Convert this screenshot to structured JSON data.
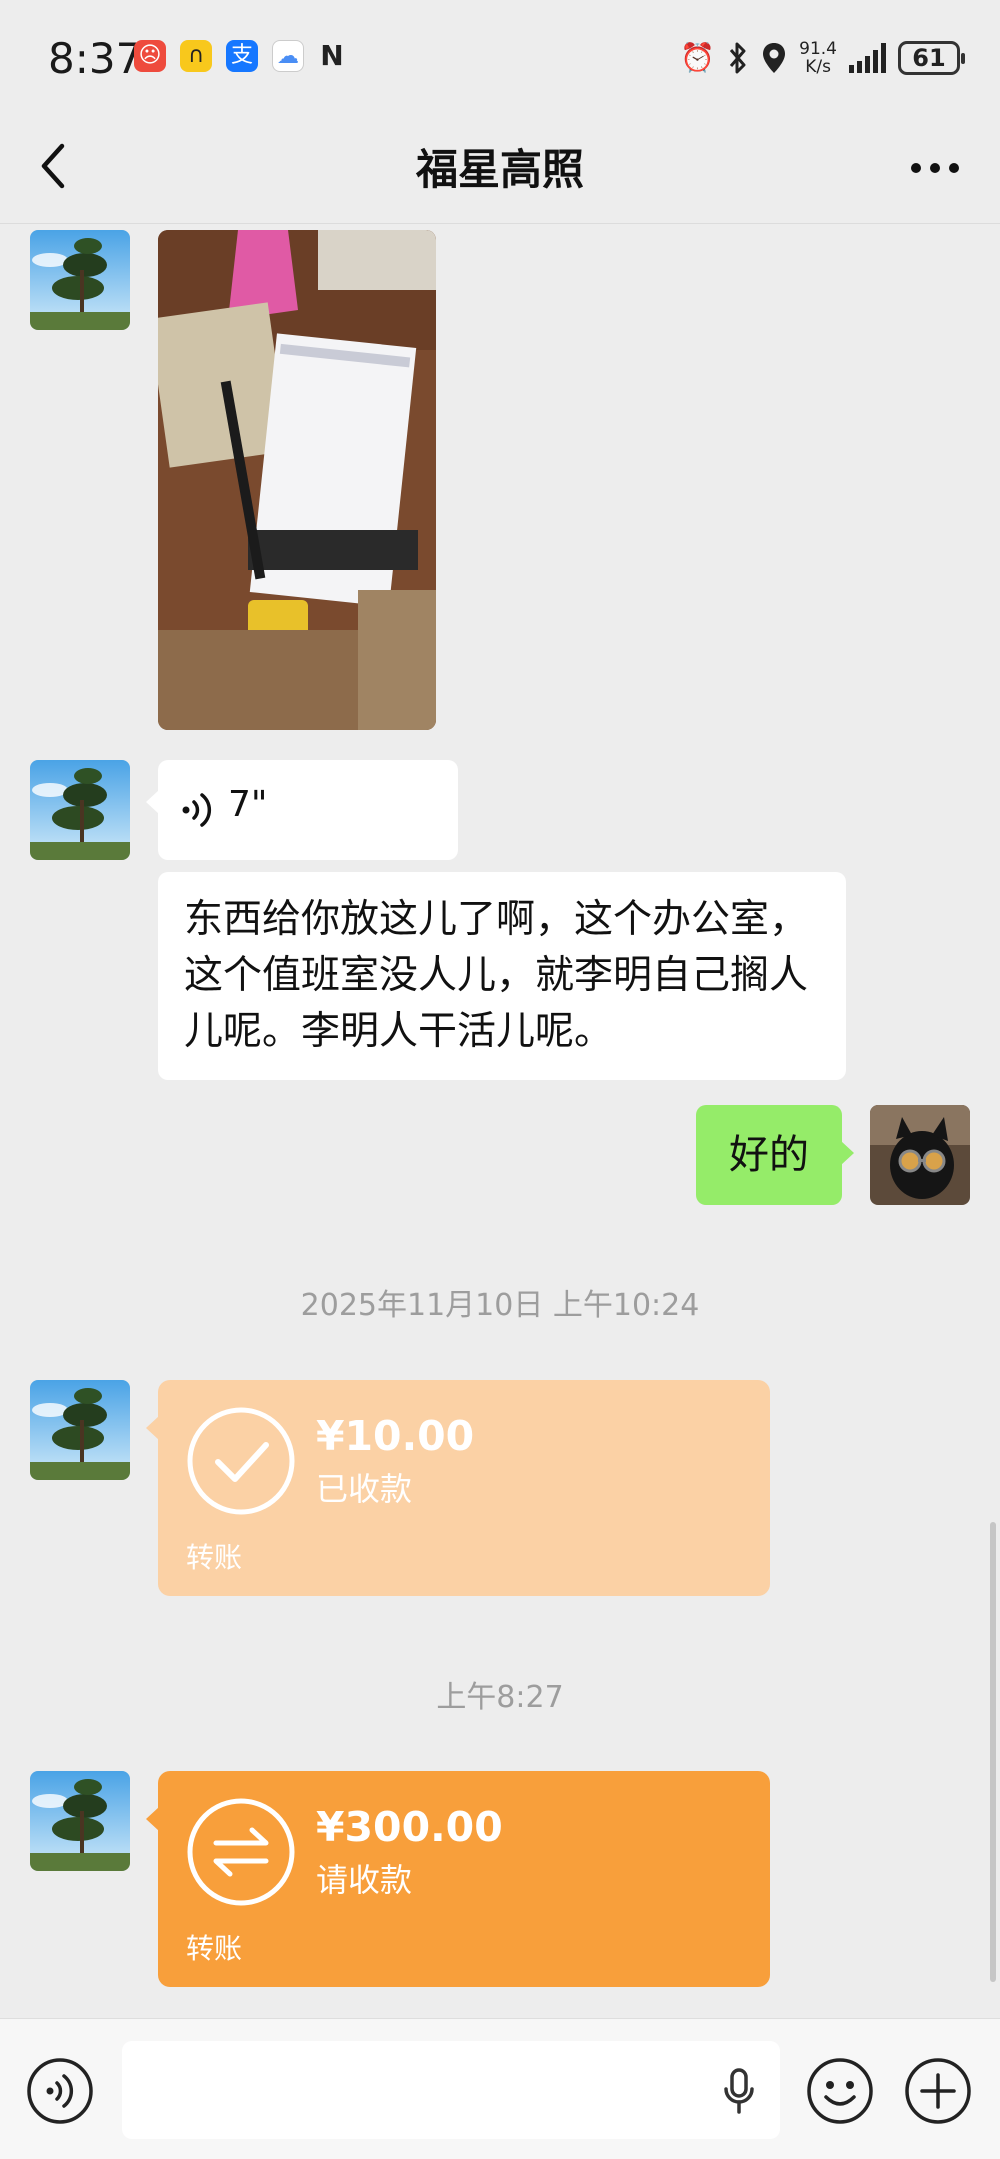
{
  "status_bar": {
    "time": "8:37",
    "net_speed_value": "91.4",
    "net_speed_unit": "K/s",
    "battery": "61",
    "icons": [
      "app-red-icon",
      "app-yellow-icon",
      "alipay-icon",
      "app-cloud-icon",
      "nfc-icon",
      "alarm-icon",
      "bluetooth-icon",
      "location-icon",
      "signal-icon",
      "battery-icon"
    ]
  },
  "header": {
    "title": "福星高照",
    "back_icon": "chevron-left-icon",
    "more_icon": "more-dots-icon"
  },
  "messages": {
    "voice": {
      "duration": "7\""
    },
    "text_peer": "东西给你放这儿了啊，这个办公室，这个值班室没人儿，就李明自己搁人儿呢。李明人干活儿呢。",
    "text_me": "好的",
    "timestamp_1": "2025年11月10日 上午10:24",
    "transfer_1": {
      "amount": "¥10.00",
      "status": "已收款",
      "label": "转账",
      "color": "#fbd1a5"
    },
    "timestamp_2": "上午8:27",
    "transfer_2": {
      "amount": "¥300.00",
      "status": "请收款",
      "label": "转账",
      "color": "#f89f3b"
    }
  },
  "input_bar": {
    "value": "",
    "left_icon": "voice-mode-icon",
    "right_icons": [
      "emoji-icon",
      "plus-icon"
    ],
    "mic_icon": "microphone-icon"
  }
}
